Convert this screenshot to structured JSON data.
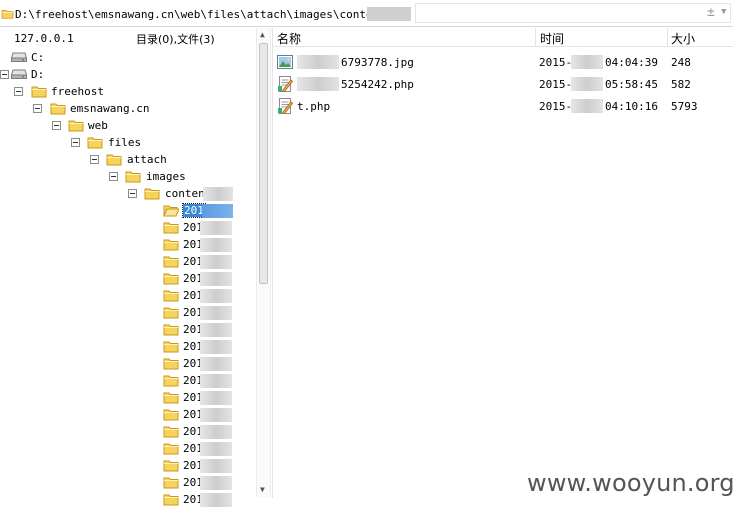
{
  "address": {
    "path_visible": "D:\\freehost\\emsnawang.cn\\web\\files\\attach\\images\\content\\20"
  },
  "left_header": {
    "host": "127.0.0.1",
    "summary": "目录(0),文件(3)"
  },
  "tree": {
    "drives": [
      "C:",
      "D:"
    ],
    "folders": [
      "freehost",
      "emsnawang.cn",
      "web",
      "files",
      "attach",
      "images",
      "content"
    ],
    "subfolders": [
      "201",
      "201",
      "201",
      "201",
      "201",
      "201",
      "201",
      "201",
      "201",
      "201",
      "201",
      "201",
      "201",
      "201",
      "201",
      "201",
      "201",
      "201"
    ]
  },
  "files": {
    "columns": {
      "name": "名称",
      "time": "时间",
      "size": "大小"
    },
    "rows": [
      {
        "name": "6793778.jpg",
        "time_prefix": "2015-",
        "time_suffix": "04:04:39",
        "size": "248",
        "icon": "image-file-icon"
      },
      {
        "name": "5254242.php",
        "time_prefix": "2015-",
        "time_suffix": "05:58:45",
        "size": "582",
        "icon": "script-file-icon"
      },
      {
        "name": "t.php",
        "time_prefix": "2015-",
        "time_suffix": "04:10:16",
        "size": "5793",
        "icon": "script-file-icon"
      }
    ]
  },
  "watermark": "www.wooyun.org",
  "colors": {
    "selection": "#3a88d8",
    "folder": "#f6d35c"
  }
}
